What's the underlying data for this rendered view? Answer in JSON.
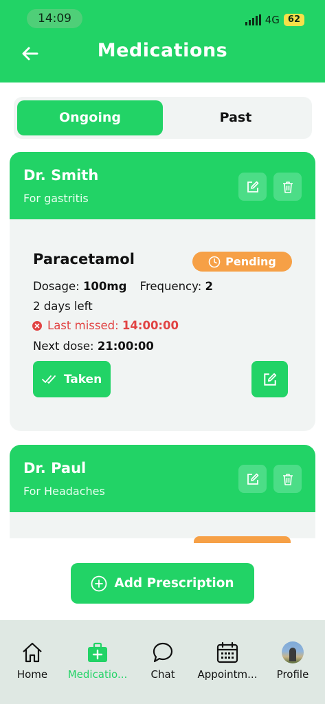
{
  "status_bar": {
    "time": "14:09",
    "network": "4G",
    "battery": "62"
  },
  "header": {
    "title": "Medications"
  },
  "tabs": [
    {
      "label": "Ongoing",
      "active": true
    },
    {
      "label": "Past",
      "active": false
    }
  ],
  "cards": [
    {
      "doctor": "Dr. Smith",
      "reason": "For gastritis",
      "medication": {
        "name": "Paracetamol",
        "status": "Pending",
        "dosage_label": "Dosage:",
        "dosage": "100mg",
        "frequency_label": "Frequency:",
        "frequency": "2",
        "days_left": "2 days left",
        "last_missed_label": "Last missed:",
        "last_missed": "14:00:00",
        "next_dose_label": "Next dose:",
        "next_dose": "21:00:00",
        "taken_label": "Taken"
      }
    },
    {
      "doctor": "Dr. Paul",
      "reason": "For Headaches"
    }
  ],
  "add_prescription_label": "Add Prescription",
  "bottom_nav": [
    {
      "label": "Home",
      "icon": "home-icon"
    },
    {
      "label": "Medicatio...",
      "icon": "medical-kit-icon",
      "active": true
    },
    {
      "label": "Chat",
      "icon": "chat-icon"
    },
    {
      "label": "Appointm...",
      "icon": "calendar-icon"
    },
    {
      "label": "Profile",
      "icon": "avatar"
    }
  ],
  "colors": {
    "brand_green": "#22d366",
    "pending_orange": "#f6a046",
    "missed_red": "#e14343"
  }
}
